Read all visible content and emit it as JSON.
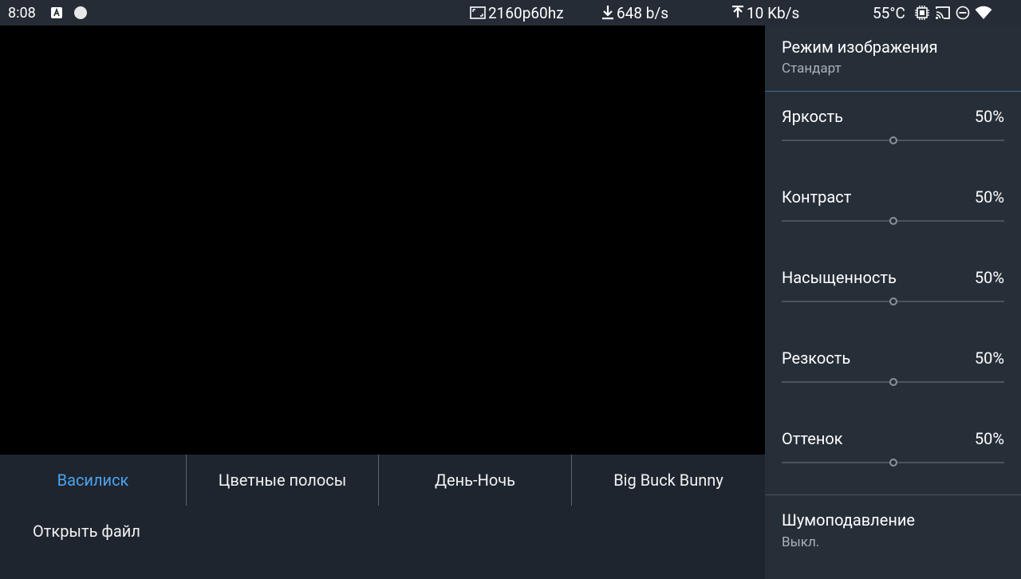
{
  "status_bar": {
    "time": "8:08",
    "resolution": "2160p60hz",
    "download": "648 b/s",
    "upload": "10 Kb/s",
    "temperature": "55°C",
    "icons": [
      "a-badge-icon",
      "circle-icon",
      "screen-icon",
      "download-icon",
      "upload-icon",
      "chip-icon",
      "cast-icon",
      "dnd-icon",
      "wifi-icon"
    ]
  },
  "tabs": [
    {
      "label": "Василиск",
      "active": true
    },
    {
      "label": "Цветные полосы",
      "active": false
    },
    {
      "label": "День-Ночь",
      "active": false
    },
    {
      "label": "Big Buck Bunny",
      "active": false
    }
  ],
  "open_file_label": "Открыть файл",
  "settings": {
    "picture_mode": {
      "title": "Режим изображения",
      "value": "Стандарт"
    },
    "sliders": [
      {
        "label": "Яркость",
        "value_text": "50%",
        "value": 50
      },
      {
        "label": "Контраст",
        "value_text": "50%",
        "value": 50
      },
      {
        "label": "Насыщенность",
        "value_text": "50%",
        "value": 50
      },
      {
        "label": "Резкость",
        "value_text": "50%",
        "value": 50
      },
      {
        "label": "Оттенок",
        "value_text": "50%",
        "value": 50
      }
    ],
    "noise_reduction": {
      "title": "Шумоподавление",
      "value": "Выкл."
    }
  },
  "colors": {
    "accent": "#4da3ec",
    "background": "#1e252f",
    "panel": "#262e38",
    "video": "#000000"
  }
}
